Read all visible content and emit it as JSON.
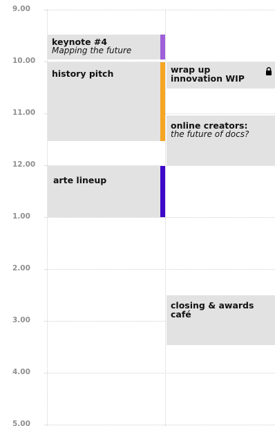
{
  "times": [
    "9.00",
    "10.00",
    "11.00",
    "12.00",
    "1.00",
    "2.00",
    "3.00",
    "4.00",
    "5.00"
  ],
  "colors": {
    "purple": "#9e5fd8",
    "orange": "#f5a623",
    "indigo": "#3d08c9",
    "event_bg": "#e2e2e2",
    "time_label": "#8f8f8f"
  },
  "events": {
    "keynote": {
      "title": "keynote #4",
      "subtitle": "Mapping the future"
    },
    "history": {
      "title": "history pitch"
    },
    "arte": {
      "title": "arte lineup"
    },
    "wrapup": {
      "title": "wrap up innovation WIP",
      "icon": "lock-icon"
    },
    "online": {
      "title": "online creators:",
      "subtitle": "the future of docs?"
    },
    "closing": {
      "title": "closing & awards café"
    }
  }
}
